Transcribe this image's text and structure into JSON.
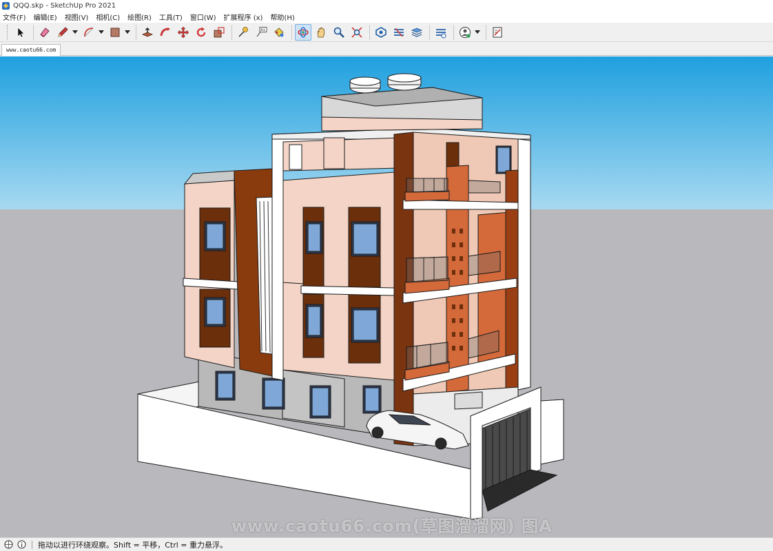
{
  "window": {
    "title": "QQQ.skp - SketchUp Pro 2021"
  },
  "menu": [
    {
      "label": "文件(F)"
    },
    {
      "label": "编辑(E)"
    },
    {
      "label": "视图(V)"
    },
    {
      "label": "相机(C)"
    },
    {
      "label": "绘图(R)"
    },
    {
      "label": "工具(T)"
    },
    {
      "label": "窗口(W)"
    },
    {
      "label": "扩展程序 (x)"
    },
    {
      "label": "帮助(H)"
    }
  ],
  "toolbar": {
    "active_tool": "orbit-icon",
    "tools": [
      "select-icon",
      "eraser-icon",
      "pencil-icon",
      "arc-icon",
      "shape-icon",
      "push-pull-icon",
      "follow-me-icon",
      "move-icon",
      "rotate-icon",
      "scale-icon",
      "tape-measure-icon",
      "text-icon",
      "paint-bucket-icon",
      "orbit-icon",
      "pan-icon",
      "zoom-icon",
      "zoom-extents-icon",
      "warehouse-icon",
      "extension-warehouse-icon",
      "layout-icon",
      "sketchup-viewer-icon",
      "account-icon",
      "make-icon"
    ]
  },
  "scene_tab": {
    "label": "www.caotu66.com"
  },
  "viewport": {
    "watermark": "www.caotu66.com(草图溜溜网) 图A",
    "sky_color": "#2ea9e3",
    "ground_color": "#b8b8bd"
  },
  "status": {
    "text": "拖动以进行环绕观察。Shift = 平移，Ctrl = 重力悬浮。"
  }
}
